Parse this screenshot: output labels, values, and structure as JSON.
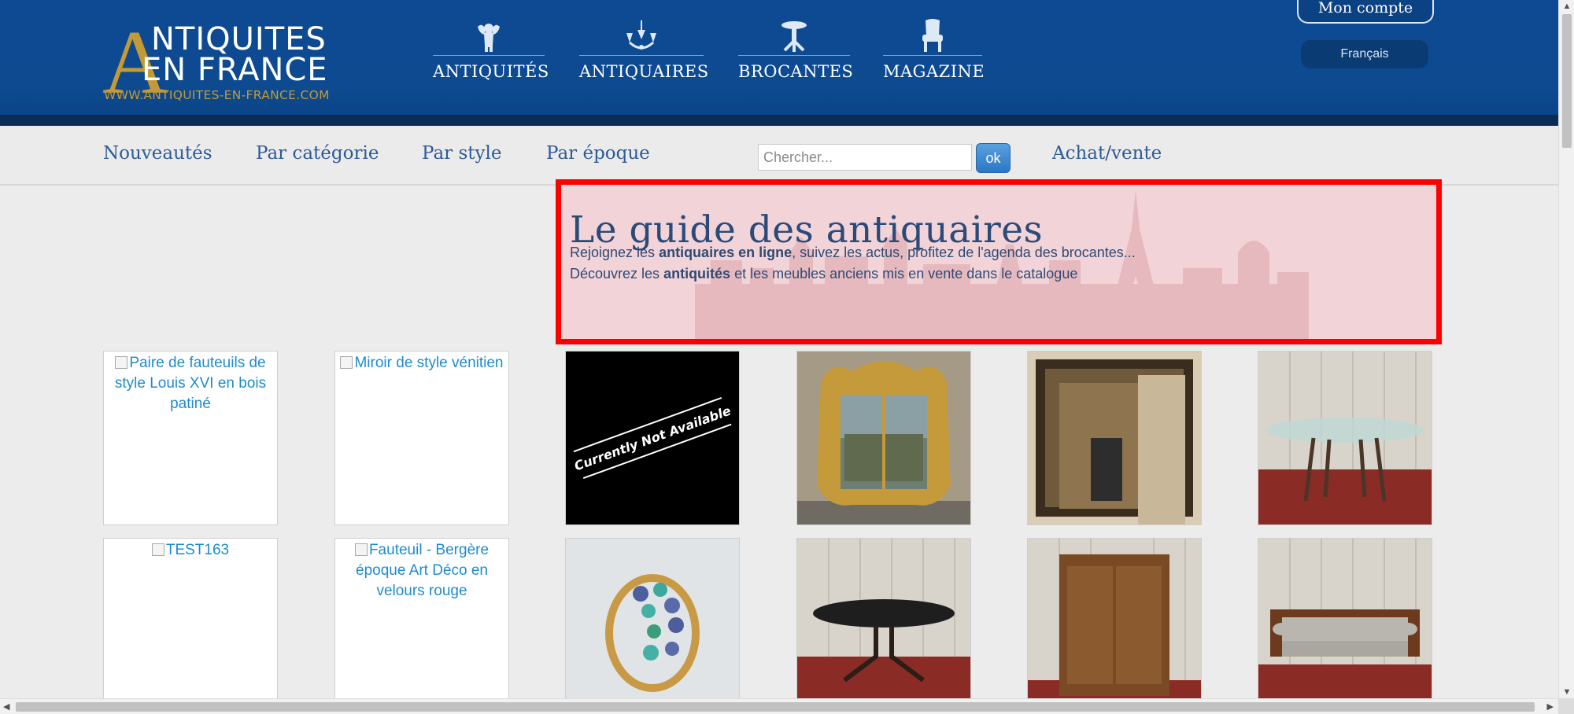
{
  "header": {
    "logo": {
      "big_letter": "A",
      "line1": "NTIQUITES",
      "line2": "EN FRANCE",
      "url": "WWW.ANTIQUITES-EN-FRANCE.COM"
    },
    "main_nav": [
      {
        "label": "ANTIQUITÉS",
        "icon": "cherub-icon"
      },
      {
        "label": "ANTIQUAIRES",
        "icon": "chandelier-icon"
      },
      {
        "label": "BROCANTES",
        "icon": "pedestal-table-icon"
      },
      {
        "label": "MAGAZINE",
        "icon": "armchair-icon"
      }
    ],
    "account_label": "Mon compte",
    "language_label": "Français"
  },
  "subnav": {
    "links": [
      "Nouveautés",
      "Par catégorie",
      "Par style",
      "Par époque"
    ],
    "search_placeholder": "Chercher...",
    "search_button": "ok",
    "achat_vente": "Achat/vente"
  },
  "guide": {
    "title": "Le guide des antiquaires",
    "line1": {
      "pre": "Rejoignez les ",
      "bold": "antiquaires en ligne",
      "post": ", suivez les actus, profitez de l'agenda des brocantes..."
    },
    "line2": {
      "pre": "Découvrez les ",
      "bold": "antiquités",
      "post": " et les meubles anciens mis en vente dans le catalogue"
    }
  },
  "products": {
    "row1": [
      {
        "alt": "Paire de fauteuils de style Louis XVI en bois patiné",
        "kind": "broken"
      },
      {
        "alt": "Miroir de style vénitien",
        "kind": "broken"
      },
      {
        "caption": "Currently Not Available",
        "kind": "unavailable"
      },
      {
        "kind": "photo-gilt-mirror"
      },
      {
        "kind": "photo-wall-mirror"
      },
      {
        "kind": "photo-glass-table"
      }
    ],
    "row2": [
      {
        "alt": "TEST163",
        "kind": "broken"
      },
      {
        "alt": "Fauteuil - Bergère époque Art Déco en velours rouge",
        "kind": "broken"
      },
      {
        "kind": "photo-ring"
      },
      {
        "kind": "photo-oval-table"
      },
      {
        "kind": "photo-cabinet"
      },
      {
        "kind": "photo-sofa"
      }
    ]
  },
  "colors": {
    "header_blue": "#0e4a93",
    "gold": "#c39a35",
    "link_blue": "#2d5a96",
    "highlight_red": "#ff0000"
  }
}
